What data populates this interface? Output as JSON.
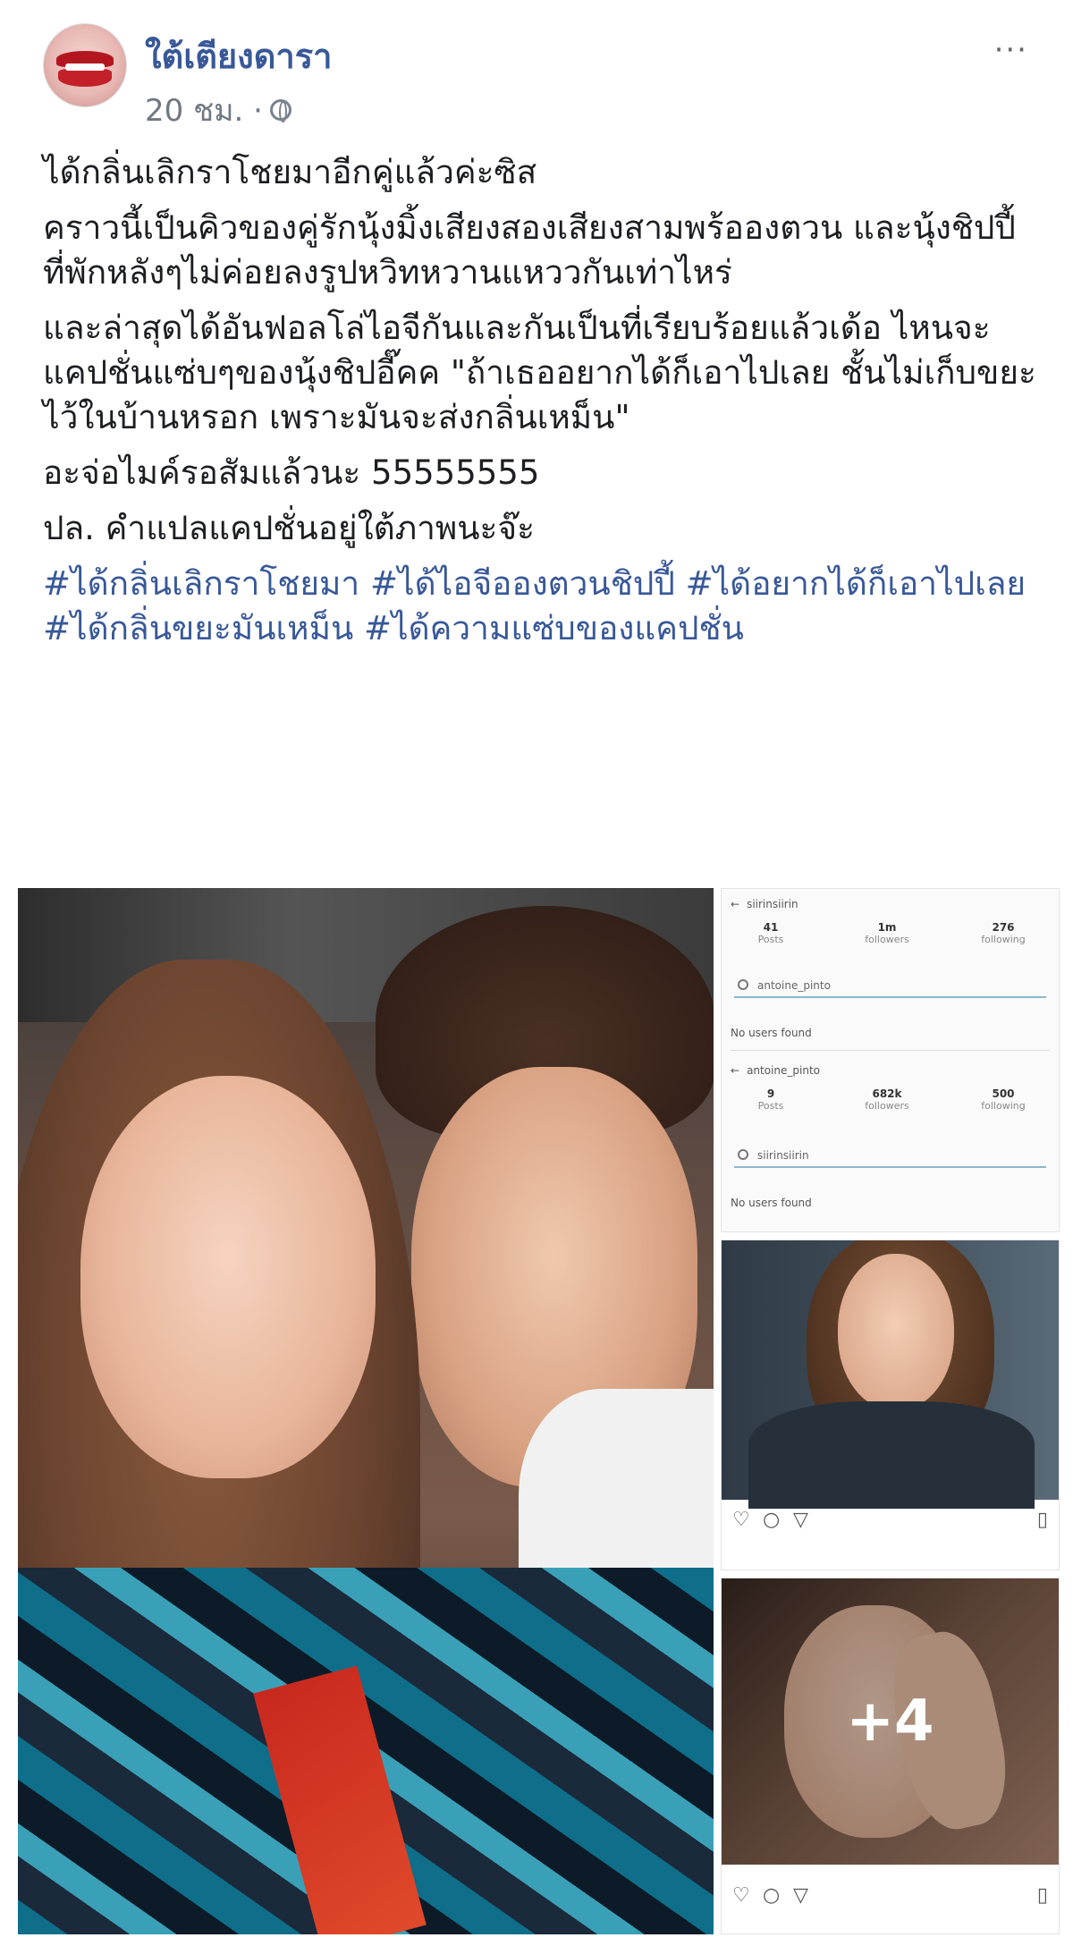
{
  "post": {
    "page_name": "ใต้เตียงดารา",
    "timestamp": "20 ชม. ·",
    "privacy_icon": "globe-icon",
    "more_label": "···"
  },
  "content": {
    "paragraphs": [
      "ได้กลิ่นเลิกราโชยมาอีกคู่แล้วค่ะซิส",
      "คราวนี้เป็นคิวของคู่รักนุ้งมิ้งเสียงสองเสียงสามพร้อองตวน และนุ้งชิปปี้ ที่พักหลังๆไม่ค่อยลงรูปหวิทหวานแหววกันเท่าไหร่",
      "และล่าสุดได้อันฟอลโล่ไอจีกันและกันเป็นที่เรียบร้อยแล้วเด้อ ไหนจะแคปชั่นแซ่บๆของนุ้งชิปอี๊คค \"ถ้าเธออยากได้ก็เอาไปเลย ชั้นไม่เก็บขยะไว้ในบ้านหรอก เพราะมันจะส่งกลิ่นเหม็น\"",
      "อะจ่อไมค์รอสัมแล้วนะ 55555555",
      "ปล. คำแปลแคปชั่นอยู่ใต้ภาพนะจ๊ะ"
    ],
    "hashtags": "#ได้กลิ่นเลิกราโชยมา #ได้ไอจีอองตวนชิปปี้ #ได้อยากได้ก็เอาไปเลย #ได้กลิ่นขยะมันเหม็น #ได้ความแซ่บของแคปชั่น"
  },
  "gallery": {
    "more_count": "+4",
    "screenshot": {
      "account_1": "siirinsiirin",
      "stats_1": [
        {
          "value": "41",
          "label": "Posts"
        },
        {
          "value": "1m",
          "label": "followers"
        },
        {
          "value": "276",
          "label": "following"
        }
      ],
      "search_1": "antoine_pinto",
      "no_results_1": "No users found",
      "account_2": "antoine_pinto",
      "stats_2": [
        {
          "value": "9",
          "label": "Posts"
        },
        {
          "value": "682k",
          "label": "followers"
        },
        {
          "value": "500",
          "label": "following"
        }
      ],
      "search_2": "siirinsiirin",
      "no_results_2": "No users found"
    },
    "action_icons": [
      "heart-icon",
      "comment-icon",
      "share-icon",
      "bookmark-icon"
    ]
  },
  "colors": {
    "link": "#385898",
    "text": "#1c1e21",
    "meta": "#6f7783"
  }
}
